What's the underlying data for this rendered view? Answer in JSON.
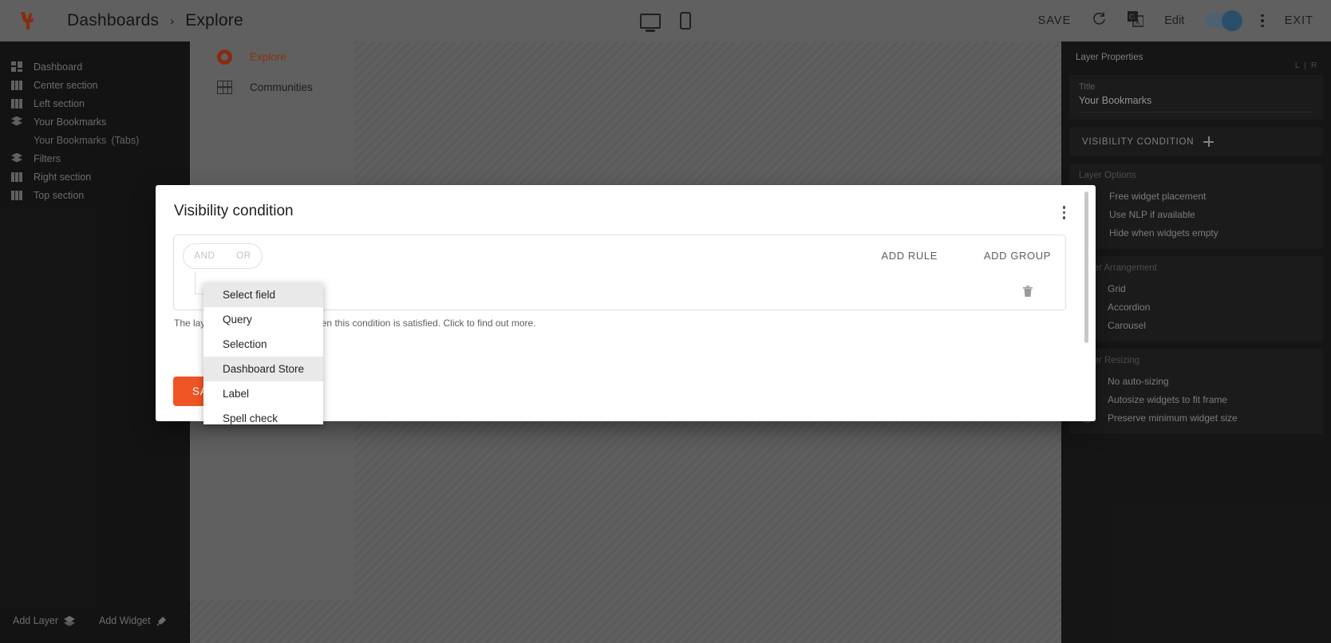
{
  "topbar": {
    "breadcrumb_root": "Dashboards",
    "breadcrumb_sep": "›",
    "breadcrumb_current": "Explore",
    "save_label": "SAVE",
    "edit_label": "Edit",
    "exit_label": "EXIT",
    "refresh_icon": "refresh-icon",
    "translate_icon": "translate-icon",
    "desktop_icon": "desktop-icon",
    "mobile_icon": "mobile-icon",
    "kebab_icon": "more-vertical-icon",
    "toggle_on": true,
    "toggle_color": "#3d7199",
    "bg_color": "#8a8a8a"
  },
  "sidebar": {
    "items": [
      {
        "label": "Dashboard",
        "icon": "dashboard-icon"
      },
      {
        "label": "Center section",
        "icon": "columns-icon"
      },
      {
        "label": "Left section",
        "icon": "columns-icon"
      },
      {
        "label": "Your Bookmarks",
        "icon": "layers-icon"
      },
      {
        "label": "Your Bookmarks (Tabs)",
        "icon": "none"
      },
      {
        "label": "Filters",
        "icon": "layers-icon"
      },
      {
        "label": "Right section",
        "icon": "columns-icon"
      },
      {
        "label": "Top section",
        "icon": "columns-icon"
      }
    ],
    "footer": {
      "add_layer": "Add Layer",
      "add_layer_icon": "layers-icon",
      "add_widget": "Add Widget",
      "add_widget_icon": "widget-pin-icon"
    }
  },
  "canvas": {
    "nav": [
      {
        "label": "Explore",
        "icon": "ring-icon",
        "active": true
      },
      {
        "label": "Communities",
        "icon": "grid-icon",
        "active": false
      }
    ],
    "accent_color": "#c2401a"
  },
  "right_panel": {
    "title": "Layer Properties",
    "lr_toggle": "L | R",
    "title_field": {
      "label": "Title",
      "value": "Your Bookmarks"
    },
    "visibility_condition": {
      "label": "VISIBILITY CONDITION",
      "icon": "plus-icon"
    },
    "layer_options": {
      "title": "Layer Options",
      "items": [
        {
          "label": "Free widget placement",
          "type": "checkbox",
          "checked": false
        },
        {
          "label": "Use NLP if available",
          "type": "checkbox",
          "checked": false
        },
        {
          "label": "Hide when widgets empty",
          "type": "checkbox",
          "checked": false
        }
      ]
    },
    "layer_arrangement": {
      "title": "Layer Arrangement",
      "items": [
        {
          "label": "Grid",
          "type": "radio",
          "checked": true
        },
        {
          "label": "Accordion",
          "type": "radio",
          "checked": false
        },
        {
          "label": "Carousel",
          "type": "radio",
          "checked": false
        }
      ]
    },
    "layer_resizing": {
      "title": "Layer Resizing",
      "items": [
        {
          "label": "No auto-sizing",
          "type": "radio",
          "checked": true
        },
        {
          "label": "Autosize widgets to fit frame",
          "type": "radio",
          "checked": false
        },
        {
          "label": "Preserve minimum widget size",
          "type": "radio",
          "checked": false
        }
      ]
    }
  },
  "modal": {
    "title": "Visibility condition",
    "kebab_icon": "more-vertical-icon",
    "operator_and": "AND",
    "operator_or": "OR",
    "add_rule": "ADD RULE",
    "add_group": "ADD GROUP",
    "delete_icon": "trash-icon",
    "helper_text": "The layer will be displayed only when this condition is satisfied. Click to find out more.",
    "save_label": "SAVE",
    "save_color": "#ef5424"
  },
  "dropdown": {
    "items": [
      {
        "label": "Select field",
        "highlighted": true
      },
      {
        "label": "Query",
        "highlighted": false
      },
      {
        "label": "Selection",
        "highlighted": false
      },
      {
        "label": "Dashboard Store",
        "highlighted": true
      },
      {
        "label": "Label",
        "highlighted": false
      },
      {
        "label": "Spell check",
        "highlighted": false
      }
    ]
  }
}
